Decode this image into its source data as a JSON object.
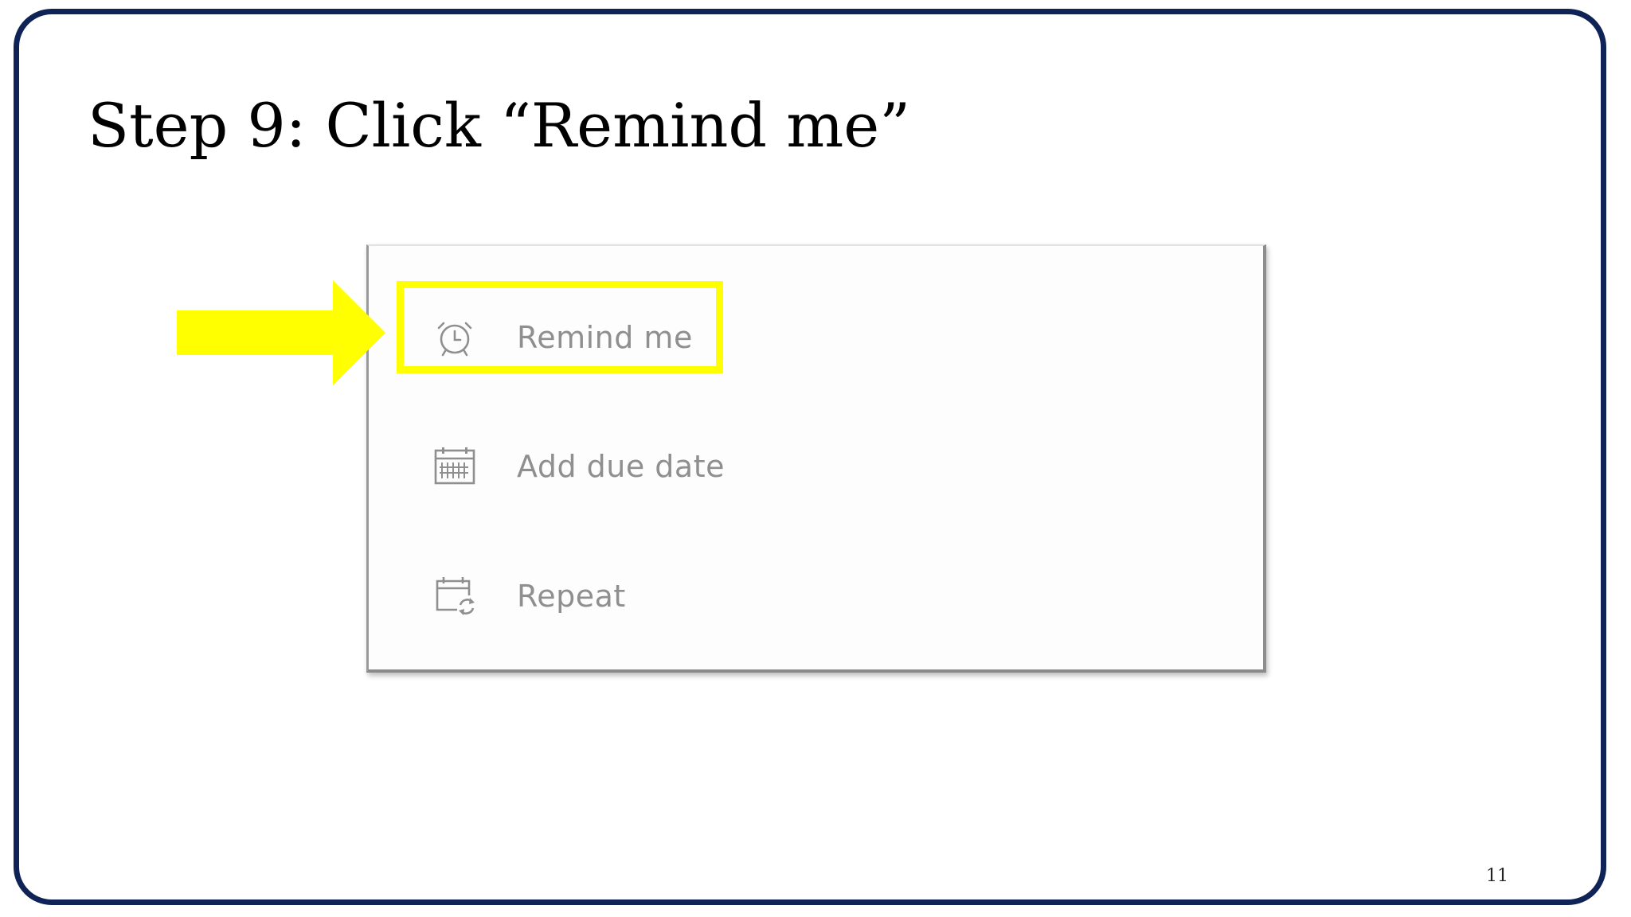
{
  "slide": {
    "title": "Step 9: Click “Remind me”",
    "page_number": "11"
  },
  "menu": {
    "items": [
      {
        "label": "Remind me",
        "icon": "alarm-clock-icon",
        "highlighted": true
      },
      {
        "label": "Add due date",
        "icon": "calendar-icon",
        "highlighted": false
      },
      {
        "label": "Repeat",
        "icon": "calendar-repeat-icon",
        "highlighted": false
      }
    ]
  },
  "colors": {
    "frame": "#0f2357",
    "highlight": "#ffff00",
    "menu_text": "#8f8f8f"
  }
}
